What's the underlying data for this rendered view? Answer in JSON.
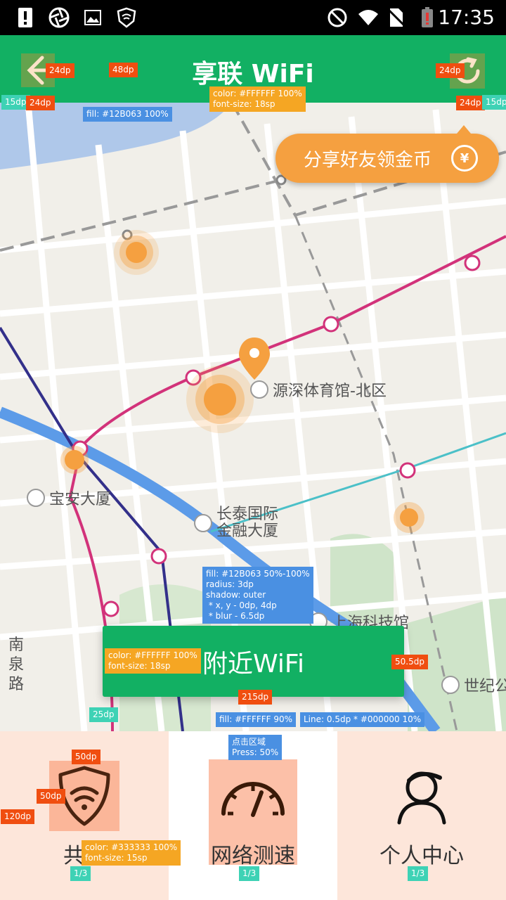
{
  "status_bar": {
    "time": "17:35"
  },
  "app_bar": {
    "title": "享联 WiFi",
    "back_icon": "arrow-left-icon",
    "refresh_icon": "refresh-icon"
  },
  "map": {
    "share_pill_text": "分享好友领金币",
    "coin_symbol": "¥",
    "pois": [
      {
        "label": "源深体育馆-北区"
      },
      {
        "label": "宝安大厦"
      },
      {
        "label": "长泰国际\n金融大厦"
      },
      {
        "label": "上海科技馆"
      },
      {
        "label": "世纪公"
      },
      {
        "label": "南\n泉\n路"
      }
    ]
  },
  "nearby_button": {
    "label": "附近WiFi"
  },
  "bottom_nav": {
    "tabs": [
      {
        "label": "共享",
        "icon": "wifi-shield-icon"
      },
      {
        "label": "网络测速",
        "icon": "speedometer-icon"
      },
      {
        "label": "个人中心",
        "icon": "person-icon"
      }
    ]
  },
  "annotations": {
    "a1": "24dp",
    "a2": "24dp",
    "a3": "48dp",
    "a4": "15dp",
    "a5": "24dp",
    "a6": "24dp",
    "a7": "15dp",
    "title_spec": "color: #FFFFFF 100%\nfont-size: 18sp",
    "bar_fill": "fill: #12B063 100%",
    "btn_spec": "fill: #12B063 50%-100%\nradius: 3dp\nshadow: outer\n * x, y - 0dp, 4dp\n * blur - 6.5dp",
    "btn_text_spec": "color: #FFFFFF 100%\nfont-size: 18sp",
    "btn_h": "50.5dp",
    "btn_w": "215dp",
    "gap": "25dp",
    "nav_fill": "fill: #FFFFFF 90%",
    "line_spec": "Line: 0.5dp * #000000 10%",
    "press_spec": "点击区域\nPress: 50%",
    "icon_w": "50dp",
    "icon_h": "50dp",
    "nav_h": "120dp",
    "label_spec": "color: #333333 100%\nfont-size: 15sp",
    "third1": "1/3",
    "third2": "1/3",
    "third3": "1/3"
  },
  "colors": {
    "primary": "#12B063",
    "accent": "#F5A040",
    "text_dark": "#333333"
  }
}
